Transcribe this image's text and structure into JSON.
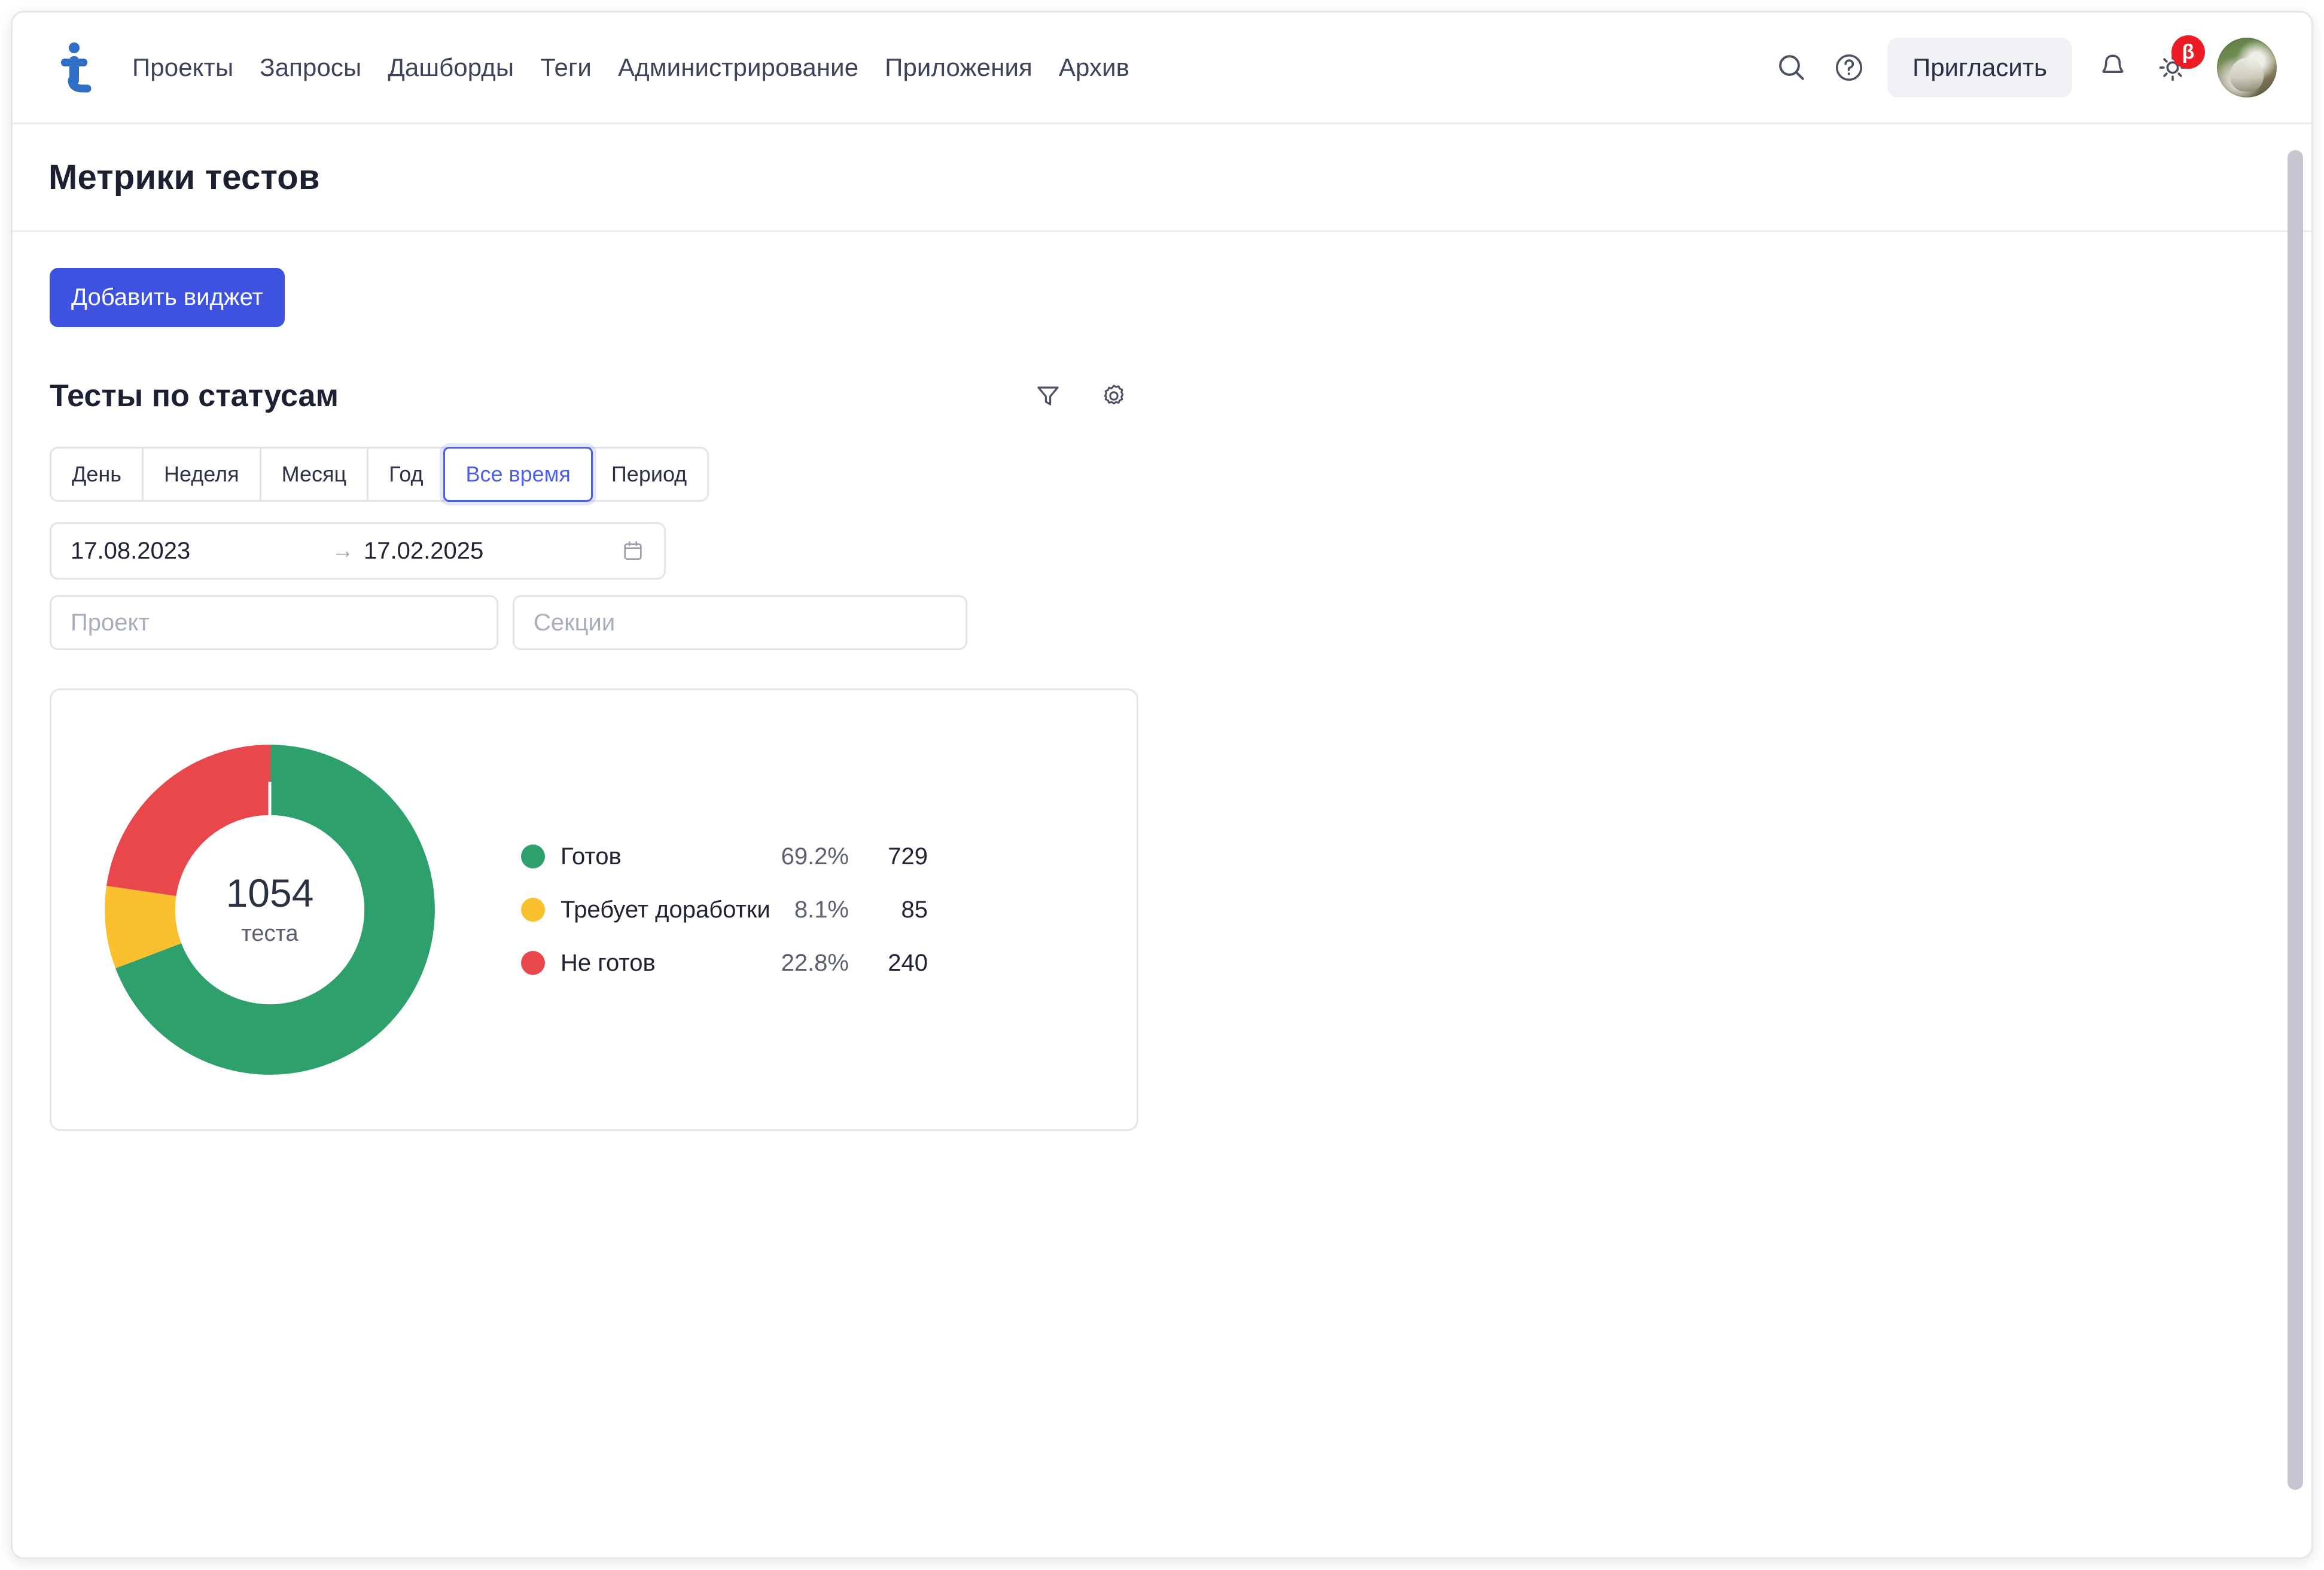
{
  "header": {
    "logo_icon": "logo-t-icon",
    "nav": [
      {
        "label": "Проекты"
      },
      {
        "label": "Запросы"
      },
      {
        "label": "Дашборды"
      },
      {
        "label": "Теги"
      },
      {
        "label": "Администрирование"
      },
      {
        "label": "Приложения"
      },
      {
        "label": "Архив"
      }
    ],
    "search_icon": "search-icon",
    "help_icon": "help-circle-icon",
    "invite_label": "Пригласить",
    "bell_icon": "bell-icon",
    "theme_icon": "sun-icon",
    "beta_badge": "β",
    "avatar_icon": "user-avatar"
  },
  "page": {
    "title": "Метрики тестов",
    "add_widget_label": "Добавить виджет"
  },
  "widget": {
    "title": "Тесты по статусам",
    "filter_icon": "filter-funnel-icon",
    "settings_icon": "gear-icon",
    "tabs": [
      {
        "label": "День",
        "active": false
      },
      {
        "label": "Неделя",
        "active": false
      },
      {
        "label": "Месяц",
        "active": false
      },
      {
        "label": "Год",
        "active": false
      },
      {
        "label": "Все время",
        "active": true
      },
      {
        "label": "Период",
        "active": false
      }
    ],
    "date_range": {
      "from": "17.08.2023",
      "arrow": "→",
      "to": "17.02.2025",
      "calendar_icon": "calendar-icon"
    },
    "filters": {
      "project_placeholder": "Проект",
      "project_value": "",
      "sections_placeholder": "Секции",
      "sections_value": ""
    }
  },
  "chart_data": {
    "type": "pie",
    "title": "Тесты по статусам",
    "variant": "donut",
    "total": 1054,
    "total_label": "1054",
    "total_unit": "теста",
    "legend_position": "right",
    "start_angle_deg": 0,
    "direction": "clockwise",
    "categories": [
      "Готов",
      "Требует доработки",
      "Не готов"
    ],
    "values": [
      729,
      85,
      240
    ],
    "percents": [
      "69.2%",
      "8.1%",
      "22.8%"
    ],
    "counts": [
      "729",
      "85",
      "240"
    ],
    "colors": [
      "#2ea06b",
      "#fbc02d",
      "#e8474b"
    ],
    "slices": [
      {
        "label": "Готов",
        "value": 729,
        "percent": "69.2%",
        "count": "729",
        "color": "#2ea06b"
      },
      {
        "label": "Требует доработки",
        "value": 85,
        "percent": "8.1%",
        "count": "85",
        "color": "#fbc02d"
      },
      {
        "label": "Не готов",
        "value": 240,
        "percent": "22.8%",
        "count": "240",
        "color": "#e8474b"
      }
    ]
  },
  "colors": {
    "accent": "#3d52df",
    "tab_active": "#4a5ee8",
    "green": "#2ea06b",
    "yellow": "#fbc02d",
    "red": "#e8474b",
    "badge_red": "#ed1c24",
    "border": "#e3e3e9"
  }
}
